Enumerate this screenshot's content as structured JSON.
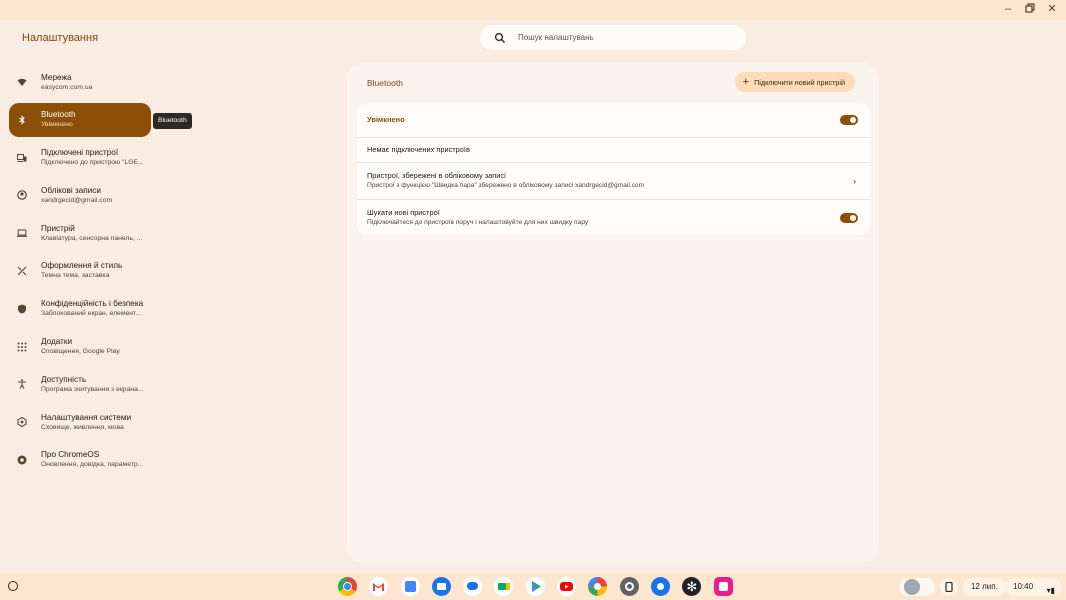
{
  "window": {
    "controls": [
      "minimize",
      "restore",
      "close"
    ]
  },
  "app": {
    "title": "Налаштування",
    "search_placeholder": "Пошук налаштувань"
  },
  "sidebar": {
    "items": [
      {
        "label": "Мережа",
        "sub": "easycom.com.ua",
        "icon": "wifi-icon"
      },
      {
        "label": "Bluetooth",
        "sub": "Увімкнено",
        "icon": "bluetooth-icon",
        "active": true
      },
      {
        "label": "Підключені пристрої",
        "sub": "Підключено до пристрою \"LGE...",
        "icon": "connected-devices-icon"
      },
      {
        "label": "Облікові записи",
        "sub": "xandrgecid@gmail.com",
        "icon": "account-icon"
      },
      {
        "label": "Пристрій",
        "sub": "Клавіатура, сенсорна панель, ...",
        "icon": "laptop-icon"
      },
      {
        "label": "Оформлення й стиль",
        "sub": "Темна тема, заставка",
        "icon": "palette-icon"
      },
      {
        "label": "Конфіденційність і безпека",
        "sub": "Заблокований екран, елемент...",
        "icon": "shield-icon"
      },
      {
        "label": "Додатки",
        "sub": "Сповіщення, Google Play",
        "icon": "apps-grid-icon"
      },
      {
        "label": "Доступність",
        "sub": "Програма зчитування з екрана...",
        "icon": "accessibility-icon"
      },
      {
        "label": "Налаштування системи",
        "sub": "Сховище, живлення, мова",
        "icon": "system-icon"
      },
      {
        "label": "Про ChromeOS",
        "sub": "Оновлення, довідка, параметр...",
        "icon": "chromeos-icon"
      }
    ],
    "tooltip": "Bluetooth"
  },
  "main": {
    "title": "Bluetooth",
    "add_button": "Підключити новий пристрій",
    "rows": [
      {
        "title": "Увімкнено",
        "toggle": true
      },
      {
        "title": "Немає підключених пристроїв"
      },
      {
        "title": "Пристрої, збережені в обліковому записі",
        "sub": "Пристрої з функцією \"Швидка пара\" збережено в обліковому записі xandrgecid@gmail.com",
        "chevron": true
      },
      {
        "title": "Шукати нові пристрої",
        "sub": "Підключайтеся до пристроїв поруч і налаштовуйте для них швидку пару",
        "toggle": true
      }
    ]
  },
  "shelf": {
    "apps": [
      "chrome",
      "gmail",
      "calendar",
      "files",
      "messages",
      "meet",
      "play-store",
      "youtube",
      "photos",
      "settings",
      "app-blue",
      "app-snowflake",
      "app-pink"
    ],
    "date": "12 лип.",
    "time": "10:40"
  },
  "colors": {
    "accent": "#8b5006",
    "background": "#fbf1e7",
    "panel": "#faf3ee"
  }
}
